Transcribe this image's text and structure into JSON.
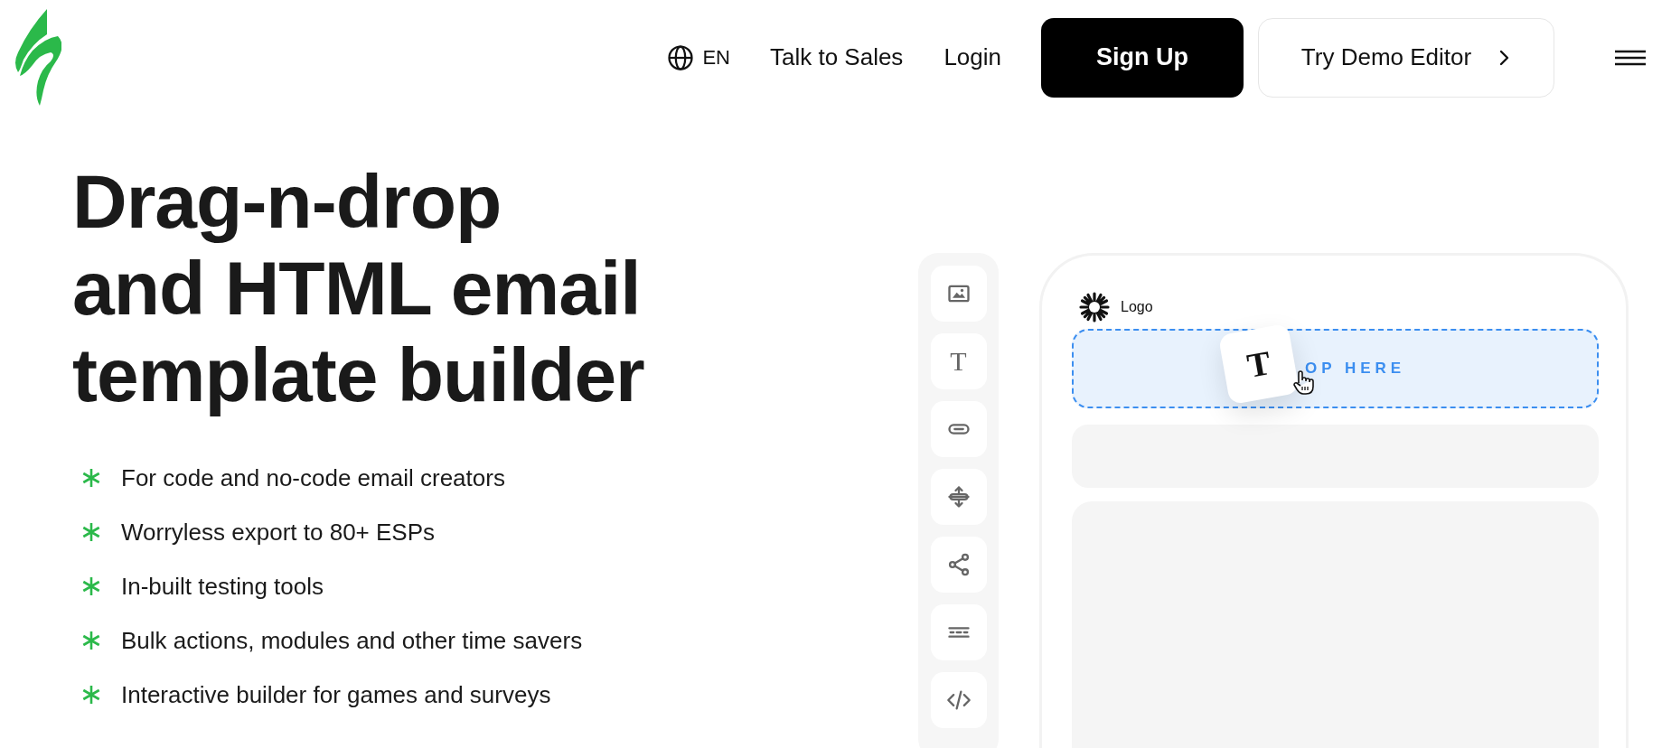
{
  "header": {
    "language": "EN",
    "links": [
      "Talk to Sales",
      "Login"
    ],
    "signup_button": "Sign Up",
    "demo_button": "Try Demo Editor"
  },
  "hero": {
    "headline": [
      "Drag-n-drop",
      "and HTML email",
      "template builder"
    ],
    "features": [
      "For code and no-code email creators",
      "Worryless export to 80+ ESPs",
      "In-built testing tools",
      "Bulk actions, modules and other time savers",
      "Interactive builder for games and surveys"
    ]
  },
  "editor_preview": {
    "tools": [
      {
        "kind": "image"
      },
      {
        "kind": "text",
        "label": "T"
      },
      {
        "kind": "button"
      },
      {
        "kind": "spacer"
      },
      {
        "kind": "social"
      },
      {
        "kind": "divider"
      },
      {
        "kind": "html"
      }
    ],
    "logo_label": "Logo",
    "drop_zone": "OP HERE",
    "dragged_block": "T"
  }
}
